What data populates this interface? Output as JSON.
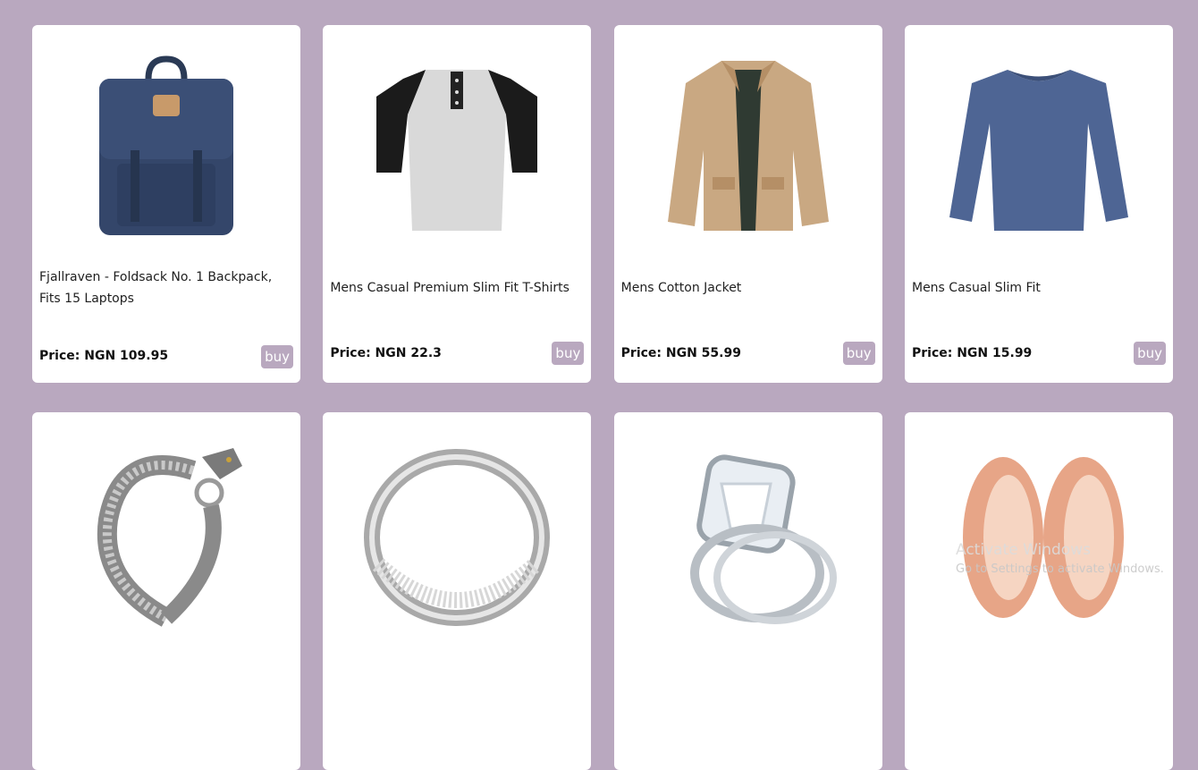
{
  "products": [
    {
      "title": "Fjallraven - Foldsack No. 1 Backpack, Fits 15 Laptops",
      "price": "Price: NGN 109.95",
      "buy": "buy",
      "image": "backpack"
    },
    {
      "title": "Mens Casual Premium Slim Fit T-Shirts",
      "price": "Price: NGN 22.3",
      "buy": "buy",
      "image": "raglan-tshirt"
    },
    {
      "title": "Mens Cotton Jacket",
      "price": "Price: NGN 55.99",
      "buy": "buy",
      "image": "jacket"
    },
    {
      "title": "Mens Casual Slim Fit",
      "price": "Price: NGN 15.99",
      "buy": "buy",
      "image": "longsleeve-shirt"
    },
    {
      "image": "dragon-bracelet"
    },
    {
      "image": "silver-ring"
    },
    {
      "image": "diamond-ring"
    },
    {
      "image": "rose-gold-plugs"
    }
  ],
  "watermark": {
    "line1": "Activate Windows",
    "line2": "Go to Settings to activate Windows."
  },
  "colors": {
    "background": "#b9a8bf",
    "card": "#ffffff",
    "button": "#b9a8bf"
  }
}
